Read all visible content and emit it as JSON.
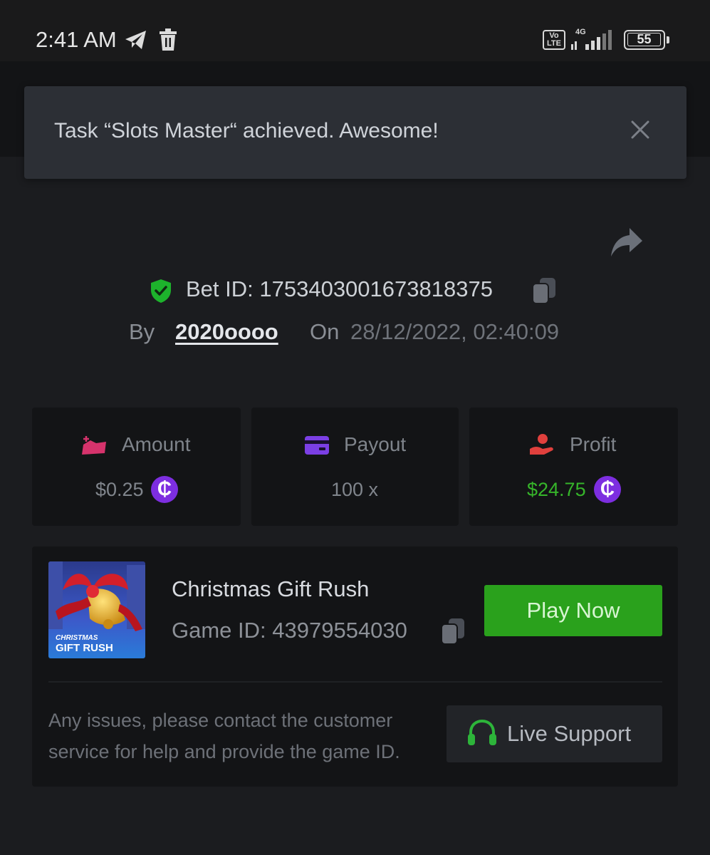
{
  "status_bar": {
    "time": "2:41 AM",
    "network_badge": "Vo LTE",
    "network_type": "4G",
    "battery_percent": "55"
  },
  "toast": {
    "message": "Task “Slots Master“ achieved. Awesome!",
    "close_icon": "close-icon"
  },
  "bet": {
    "bet_id_text": "Bet ID: 1753403001673818375",
    "by_label": "By",
    "username": "2020oooo",
    "on_label": "On",
    "date": "28/12/2022, 02:40:09"
  },
  "stats": {
    "amount": {
      "label": "Amount",
      "value": "$0.25",
      "currency_symbol": "₵"
    },
    "payout": {
      "label": "Payout",
      "value": "100 x"
    },
    "profit": {
      "label": "Profit",
      "value": "$24.75",
      "currency_symbol": "₵"
    }
  },
  "game": {
    "name": "Christmas Gift Rush",
    "id_text": "Game ID: 43979554030",
    "thumbnail_title_top": "CHRISTMAS",
    "thumbnail_title_bottom": "GIFT RUSH",
    "play_label": "Play Now"
  },
  "support": {
    "help_text": "Any issues, please contact the customer service for help and provide the game ID.",
    "button_label": "Live Support"
  },
  "colors": {
    "background": "#1b1c1f",
    "card": "#131416",
    "play_green": "#2aa11c",
    "profit_green": "#36b52a",
    "coin_purple": "#7d2ee0",
    "shield_green": "#1db32c"
  }
}
